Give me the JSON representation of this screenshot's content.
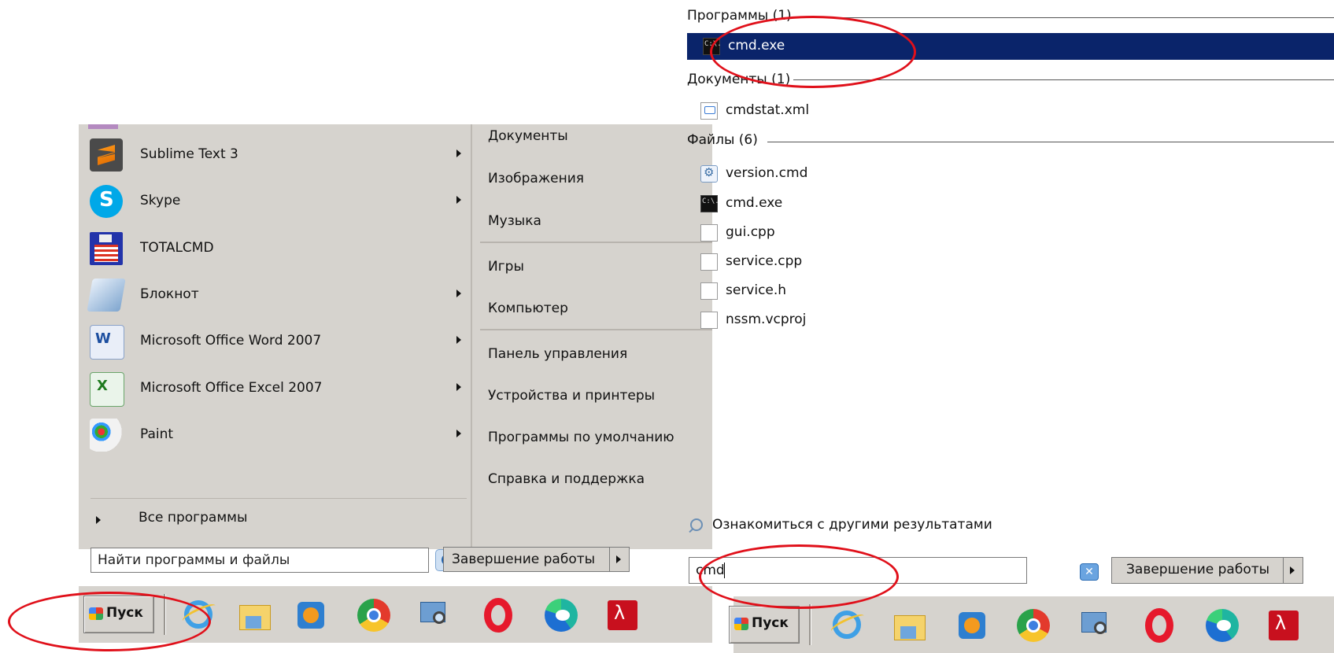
{
  "left_menu": {
    "programs": [
      {
        "label": "Sublime Text 3",
        "icon": "sublime-text-icon",
        "has_submenu": true
      },
      {
        "label": "Skype",
        "icon": "skype-icon",
        "has_submenu": true
      },
      {
        "label": "TOTALCMD",
        "icon": "totalcmd-icon",
        "has_submenu": false
      },
      {
        "label": "Блокнот",
        "icon": "notepad-icon",
        "has_submenu": true
      },
      {
        "label": "Microsoft Office Word 2007",
        "icon": "word-icon",
        "has_submenu": true
      },
      {
        "label": "Microsoft Office Excel 2007",
        "icon": "excel-icon",
        "has_submenu": true
      },
      {
        "label": "Paint",
        "icon": "paint-icon",
        "has_submenu": true
      }
    ],
    "all_programs_label": "Все программы",
    "places": [
      "Документы",
      "Изображения",
      "Музыка",
      "Игры",
      "Компьютер",
      "Панель управления",
      "Устройства и принтеры",
      "Программы по умолчанию",
      "Справка и поддержка"
    ],
    "search_placeholder": "Найти программы и файлы",
    "shutdown_label": "Завершение работы"
  },
  "taskbar": {
    "start_label": "Пуск",
    "icons": [
      "internet-explorer-icon",
      "file-explorer-icon",
      "media-player-icon",
      "chrome-icon",
      "network-search-icon",
      "opera-icon",
      "edge-icon",
      "acrobat-icon"
    ]
  },
  "right_menu": {
    "groups": {
      "programs_header": "Программы (1)",
      "documents_header": "Документы (1)",
      "files_header": "Файлы (6)"
    },
    "selected_program": "cmd.exe",
    "documents": [
      "cmdstat.xml"
    ],
    "files": [
      {
        "label": "version.cmd",
        "icon": "script-file-icon"
      },
      {
        "label": "cmd.exe",
        "icon": "console-icon"
      },
      {
        "label": "gui.cpp",
        "icon": "file-icon"
      },
      {
        "label": "service.cpp",
        "icon": "file-icon"
      },
      {
        "label": "service.h",
        "icon": "file-icon"
      },
      {
        "label": "nssm.vcproj",
        "icon": "file-icon"
      }
    ],
    "see_more_label": "Ознакомиться с другими результатами",
    "search_value": "cmd",
    "shutdown_label": "Завершение работы"
  },
  "colors": {
    "menu_bg": "#d6d3ce",
    "selection": "#0a246a",
    "highlight_oval": "#e0101a"
  }
}
